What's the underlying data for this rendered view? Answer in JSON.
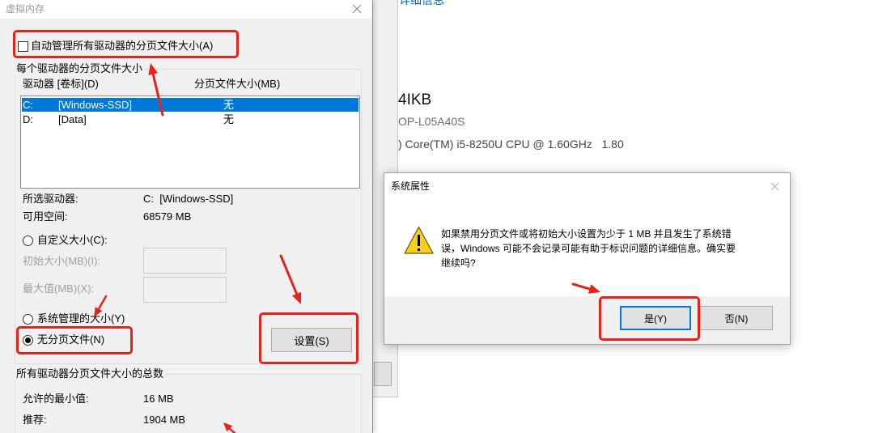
{
  "virtual_memory_dialog": {
    "title": "虚拟内存",
    "auto_manage": {
      "label": "自动管理所有驱动器的分页文件大小(A)",
      "checked": false
    },
    "per_drive_group": {
      "label": "每个驱动器的分页文件大小",
      "columns": {
        "drive": "驱动器 [卷标](D)",
        "paging_size": "分页文件大小(MB)"
      },
      "drives": [
        {
          "letter": "C:",
          "volume_label": "[Windows-SSD]",
          "paging_size": "无",
          "selected": true
        },
        {
          "letter": "D:",
          "volume_label": "[Data]",
          "paging_size": "无",
          "selected": false
        }
      ],
      "selected_drive": {
        "label": "所选驱动器:",
        "value": "C:  [Windows-SSD]"
      },
      "free_space": {
        "label": "可用空间:",
        "value": "68579 MB"
      },
      "options": {
        "custom_size": "自定义大小(C):",
        "initial_size": "初始大小(MB)(I):",
        "max_size": "最大值(MB)(X):",
        "system_managed": "系统管理的大小(Y)",
        "no_paging_file": "无分页文件(N)"
      },
      "selected_option": "no_paging_file",
      "set_button": "设置(S)"
    },
    "totals_group": {
      "label": "所有驱动器分页文件大小的总数",
      "min_allowed": {
        "label": "允许的最小值:",
        "value": "16 MB"
      },
      "recommended": {
        "label": "推荐:",
        "value": "1904 MB"
      }
    }
  },
  "background_window": {
    "details_link": "详细信息",
    "memory_fragment": "4IKB",
    "device_name_fragment": "OP-L05A40S",
    "processor_fragment": ") Core(TM) i5-8250U CPU @ 1.60GHz   1.80"
  },
  "system_properties_dialog": {
    "title": "系统属性",
    "message_lines": [
      "如果禁用分页文件或将初始大小设置为少于 1 MB 并且发生了系统错",
      "误，Windows 可能不会记录可能有助于标识问题的详细信息。确实要",
      "继续吗?"
    ],
    "yes_button": "是(Y)",
    "no_button": "否(N)",
    "yes_default": true
  },
  "icons": {
    "close": "close-icon",
    "warning": "warning-icon"
  },
  "colors": {
    "highlight_red": "#e4231d",
    "selection_blue": "#0078d7",
    "warning_yellow": "#f8d01c"
  }
}
